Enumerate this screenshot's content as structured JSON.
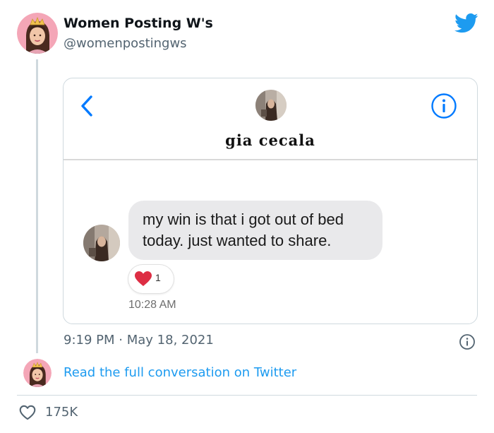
{
  "tweet": {
    "display_name": "Women Posting W's",
    "handle": "@womenpostingws",
    "avatar_icon": "crowned-woman-avatar",
    "logo_icon": "twitter-bird-icon",
    "brand_color": "#1d9bf0",
    "time": "9:19 PM",
    "separator": "·",
    "date": "May 18, 2021",
    "read_full_link": "Read the full conversation on Twitter",
    "likes": "175K"
  },
  "embedded_screenshot": {
    "contact_name": "gia cecala",
    "back_icon": "chevron-left-icon",
    "info_icon": "info-circle-icon",
    "message": {
      "text": "my win is that i got out of bed today. just wanted to share.",
      "reaction_icon": "red-heart-icon",
      "reaction_count": "1",
      "time": "10:28 AM"
    },
    "ios_blue": "#007aff",
    "bubble_color": "#e9e9eb"
  }
}
